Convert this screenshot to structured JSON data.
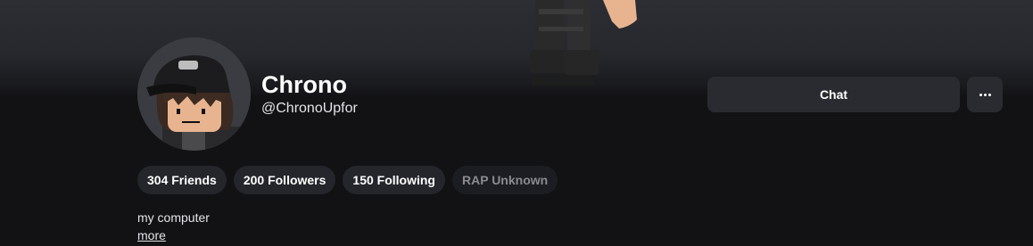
{
  "profile": {
    "display_name": "Chrono",
    "username": "@ChronoUpfor",
    "bio": "my computer",
    "more_label": "more"
  },
  "actions": {
    "chat_label": "Chat",
    "more_icon": "ellipsis-icon"
  },
  "stats": [
    {
      "label": "304 Friends"
    },
    {
      "label": "200 Followers"
    },
    {
      "label": "150 Following"
    },
    {
      "label": "RAP Unknown"
    }
  ],
  "colors": {
    "background": "#121215",
    "banner": "#2c2e34",
    "button": "#2a2b31",
    "pill": "#25262c",
    "muted_text": "#8a8b91"
  }
}
